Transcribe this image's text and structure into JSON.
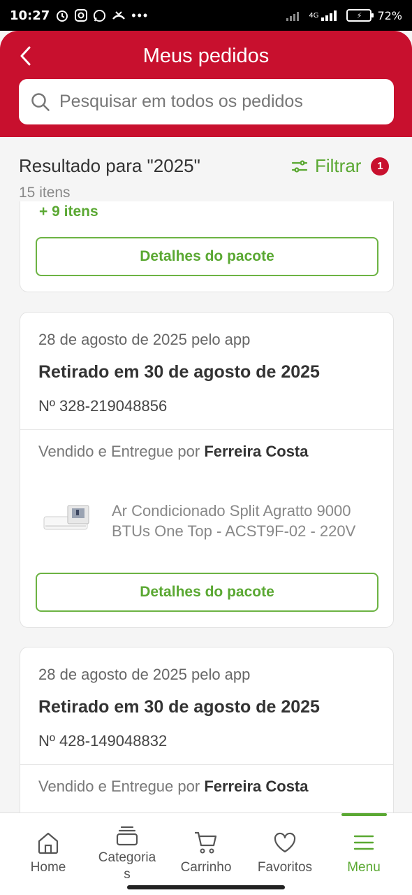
{
  "status_bar": {
    "time": "10:27",
    "network": "4G",
    "battery": "72%"
  },
  "header": {
    "title": "Meus pedidos",
    "search_placeholder": "Pesquisar em todos os pedidos"
  },
  "results": {
    "label": "Resultado para \"2025\"",
    "count": "15 itens",
    "filter_label": "Filtrar",
    "filter_count": "1"
  },
  "partial_card": {
    "more_items": "+ 9 itens",
    "details_button": "Detalhes do pacote"
  },
  "orders": [
    {
      "date": "28 de agosto de 2025 pelo app",
      "status": "Retirado em 30 de agosto de 2025",
      "number": "Nº 328-219048856",
      "seller_prefix": "Vendido e Entregue por",
      "seller": "Ferreira Costa",
      "product": "Ar Condicionado Split Agratto 9000 BTUs One Top - ACST9F-02 - 220V",
      "details_button": "Detalhes do pacote"
    },
    {
      "date": "28 de agosto de 2025 pelo app",
      "status": "Retirado em 30 de agosto de 2025",
      "number": "Nº 428-149048832",
      "seller_prefix": "Vendido e Entregue por",
      "seller": "Ferreira Costa"
    }
  ],
  "bottom_nav": [
    {
      "label": "Home",
      "icon": "home-icon"
    },
    {
      "label": "Categoria\ns",
      "icon": "categories-icon"
    },
    {
      "label": "Carrinho",
      "icon": "cart-icon"
    },
    {
      "label": "Favoritos",
      "icon": "heart-icon"
    },
    {
      "label": "Menu",
      "icon": "menu-icon",
      "active": true
    }
  ],
  "colors": {
    "brand_red": "#c8102e",
    "accent_green": "#5aa832"
  }
}
